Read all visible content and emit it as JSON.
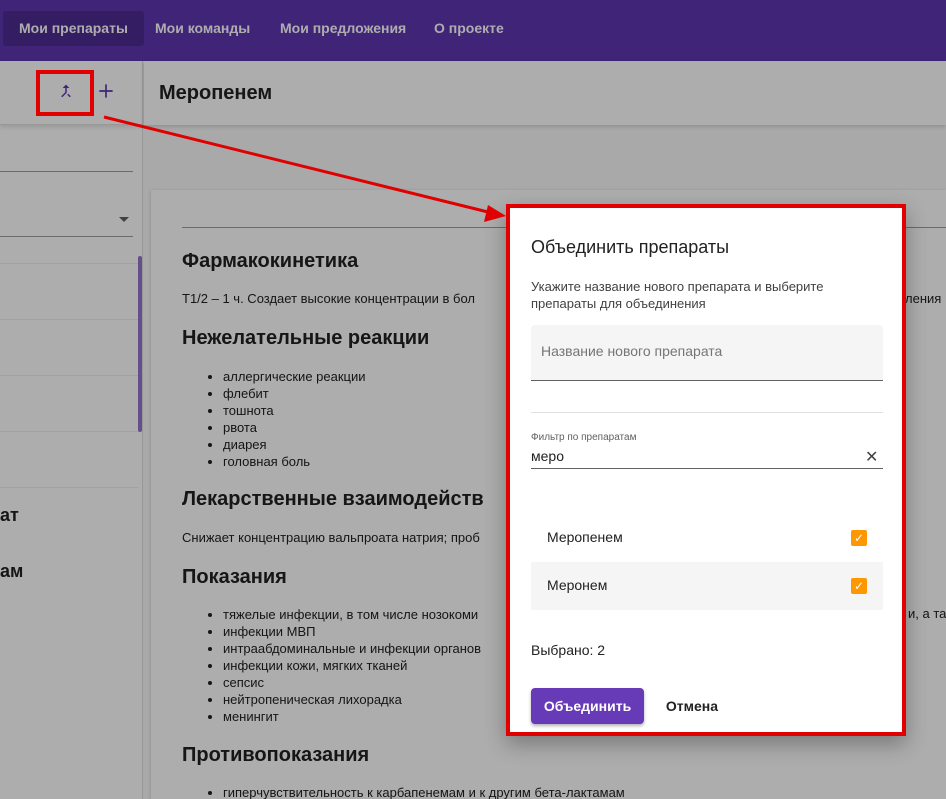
{
  "nav": {
    "items": [
      {
        "label": "Мои препараты",
        "active": true
      },
      {
        "label": "Мои команды",
        "active": false
      },
      {
        "label": "Мои предложения",
        "active": false
      },
      {
        "label": "О проекте",
        "active": false
      }
    ]
  },
  "sidebar": {
    "merge_icon": "merge-icon",
    "add_icon": "plus-icon",
    "visible_fragments": [
      "ат",
      "ам"
    ]
  },
  "content": {
    "title": "Меропенем",
    "sections": {
      "pharma_heading": "Фармакокинетика",
      "pharma_text": "Т1/2 – 1 ч. Создает высокие концентрации в бол",
      "pharma_text_right": "ления",
      "adverse_heading": "Нежелательные реакции",
      "adverse_items": [
        "аллергические реакции",
        "флебит",
        "тошнота",
        "рвота",
        "диарея",
        "головная боль"
      ],
      "interactions_heading": "Лекарственные взаимодейств",
      "interactions_text": "Снижает концентрацию вальпроата натрия; проб",
      "indications_heading": "Показания",
      "indications_items": [
        "тяжелые инфекции, в том числе нозокоми",
        "инфекции МВП",
        "интраабдоминальные и инфекции органов",
        "инфекции кожи, мягких тканей",
        "сепсис",
        "нейтропеническая лихорадка",
        "менингит"
      ],
      "indications_right": "и, а так",
      "contra_heading": "Противопоказания",
      "contra_items": [
        "гиперчувствительность к карбапенемам и к другим бета-лактамам"
      ]
    }
  },
  "dialog": {
    "title": "Объединить препараты",
    "description": "Укажите название нового препарата и выберите препараты для объединения",
    "name_placeholder": "Название нового препарата",
    "filter_label": "Фильтр по препаратам",
    "filter_value": "меро",
    "items": [
      {
        "label": "Меропенем",
        "checked": true
      },
      {
        "label": "Меронем",
        "checked": true
      }
    ],
    "selected_text": "Выбрано: 2",
    "merge_button": "Объединить",
    "cancel_button": "Отмена",
    "check_color": "#ff9800",
    "primary_color": "#673ab7"
  },
  "colors": {
    "nav_bg": "#5e35b1",
    "annotation": "#e00000"
  }
}
